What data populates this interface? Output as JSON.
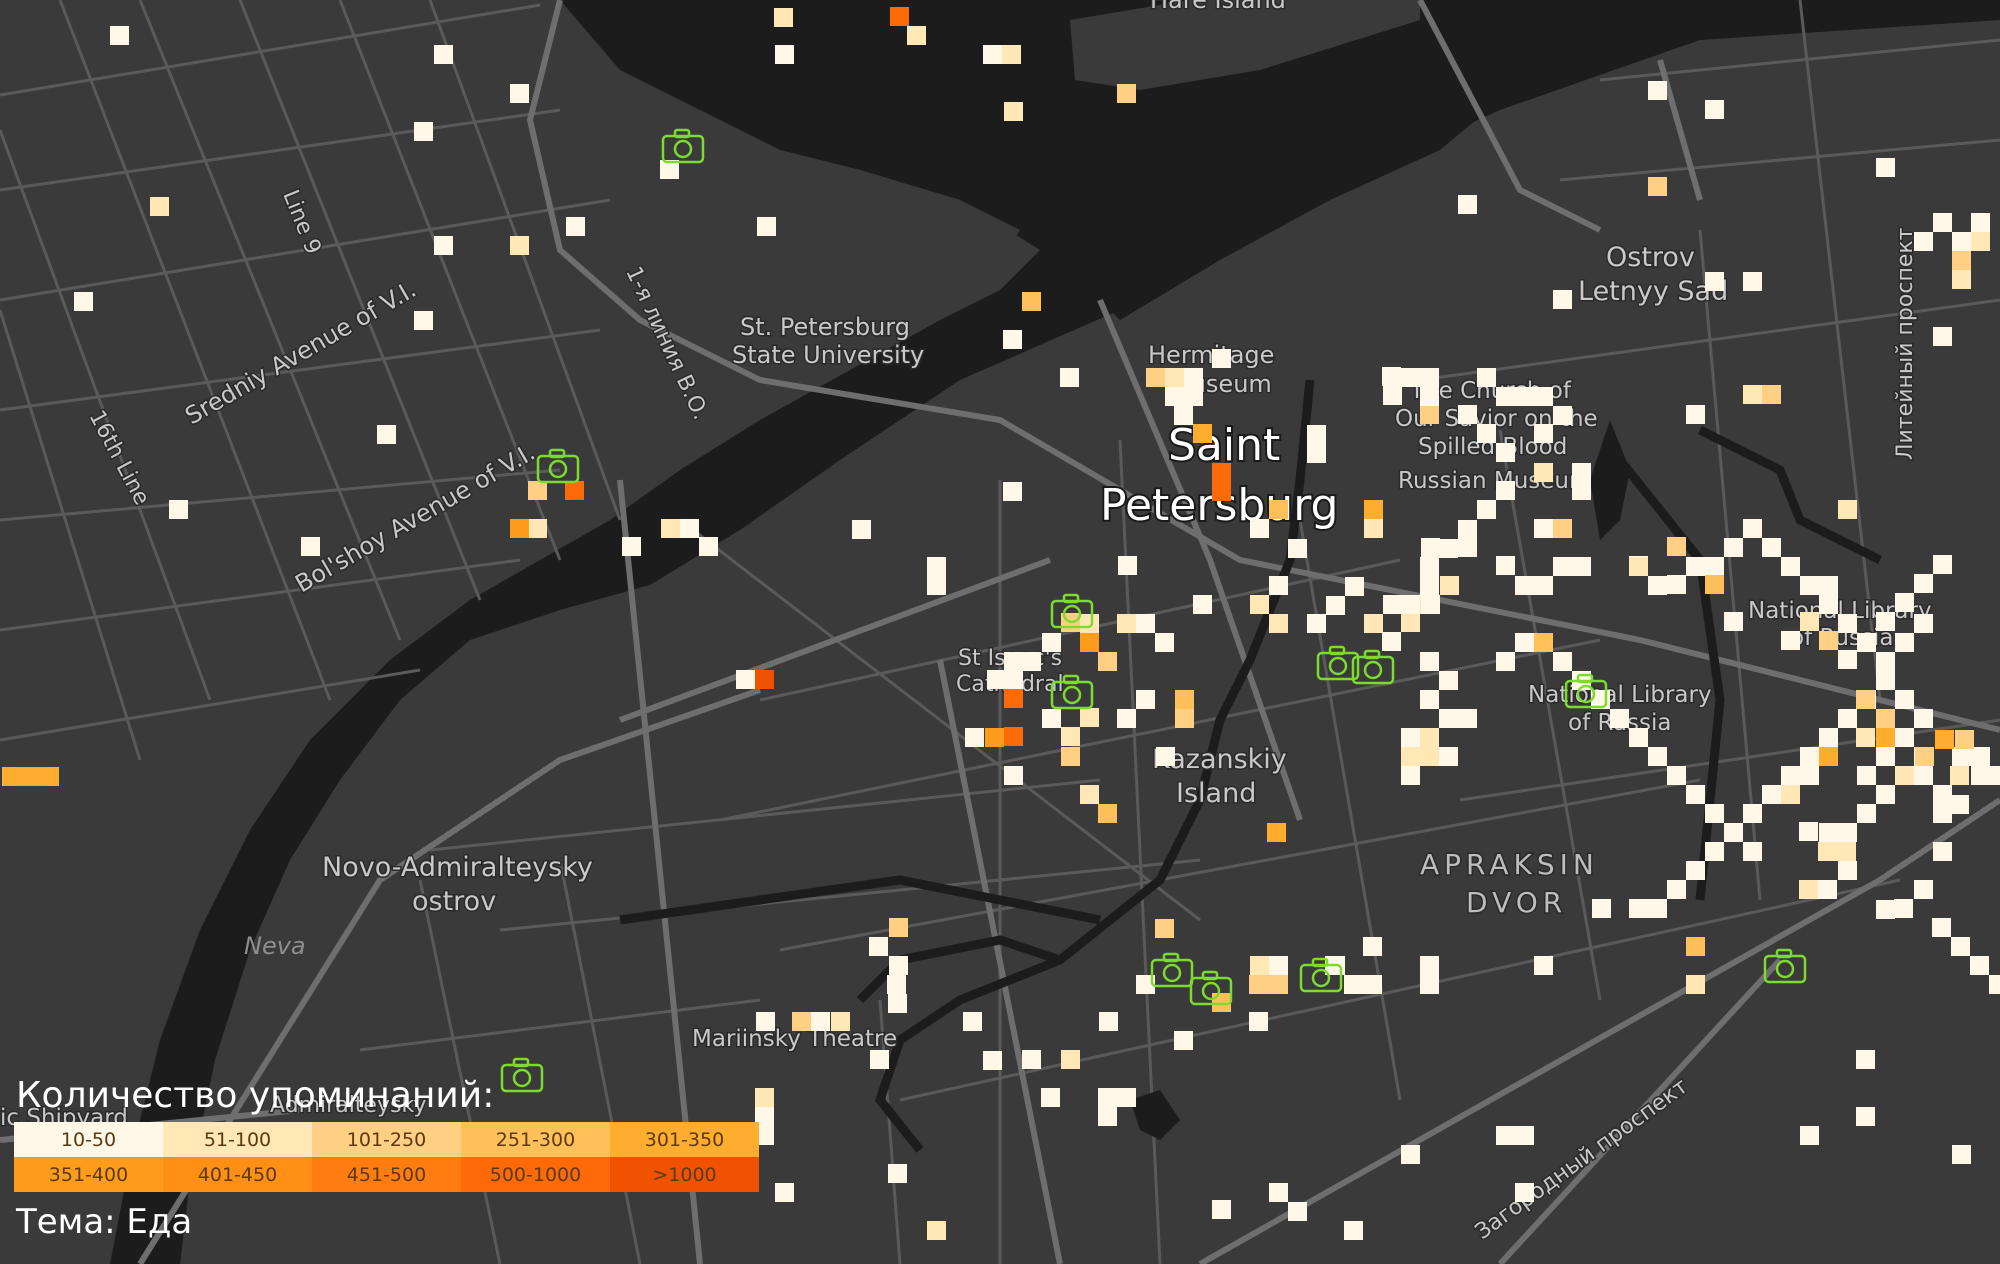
{
  "map": {
    "labels": {
      "hare_island": "Hare Island",
      "line9": "Line 9",
      "line16": "16th Line",
      "sredniy": "Sredniy Avenue of V.I.",
      "bolshoy": "Bol'shoy Avenue of V.I.",
      "first_line": "1-я линия В.О.",
      "university": "St. Petersburg",
      "university2": "State University",
      "hermitage": "Hermitage",
      "hermitage2": "Museum",
      "city1": "Saint",
      "city2": "Petersburg",
      "church1": "The Church of",
      "church2": "Our Savior on the",
      "church3": "Spilled Blood",
      "russian_museum": "Russian Museum",
      "letny1": "Ostrov",
      "letny2": "Letnyy Sad",
      "liteyny": "Литейный проспект",
      "nat_lib_a1": "National Library",
      "nat_lib_a2": "of Russia",
      "nat_lib_b1": "National Library",
      "nat_lib_b2": "of Russia",
      "isaac1": "St Isaac's",
      "isaac2": "Cathedral",
      "kazanskiy1": "Kazanskiy",
      "kazanskiy2": "Island",
      "apraksin1": "APRAKSIN",
      "apraksin2": "DVOR",
      "novo1": "Novo-Admiralteysky",
      "novo2": "ostrov",
      "neva": "Neva",
      "mariinsky": "Mariinsky Theatre",
      "zagorodny": "Загородный проспект",
      "shipyard": "ic Shipyard",
      "admiralteysky": "Admiralteysky"
    }
  },
  "legend": {
    "title": "Количество упоминаний:",
    "bins": [
      {
        "label": "10-50",
        "color": "#fff8e8"
      },
      {
        "label": "51-100",
        "color": "#ffe7b6"
      },
      {
        "label": "101-250",
        "color": "#ffd083"
      },
      {
        "label": "251-300",
        "color": "#ffc05a"
      },
      {
        "label": "301-350",
        "color": "#ffad2e"
      },
      {
        "label": "351-400",
        "color": "#ff9c1c"
      },
      {
        "label": "401-450",
        "color": "#ff8f15"
      },
      {
        "label": "451-500",
        "color": "#ff7d10"
      },
      {
        "label": "500-1000",
        "color": "#ff6a08"
      },
      {
        "label": ">1000",
        "color": "#f15200"
      }
    ]
  },
  "theme": "Тема: Еда",
  "colors": {
    "land": "#3a3a3a",
    "water": "#1c1c1c",
    "road": "#5c5c5c",
    "photo_icon": "#7bdc2e"
  },
  "icons": {
    "photo": "camera-icon"
  }
}
